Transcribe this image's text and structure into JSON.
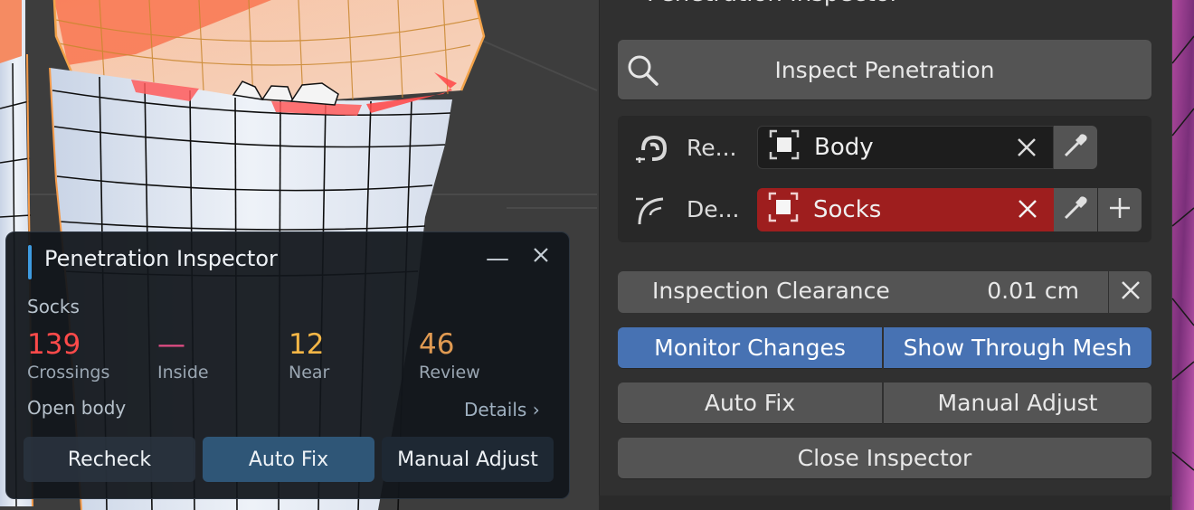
{
  "colors": {
    "accent_blue": "#4772b3",
    "socks_red": "#9e1e1e",
    "crossings": "#ff4a4a",
    "inside": "#e34d85",
    "near": "#f4b646",
    "review": "#e09a52"
  },
  "panel": {
    "title": "Penetration Inspector",
    "inspect_label": "Inspect Penetration",
    "reference_label": "Re...",
    "reference_object": "Body",
    "deformed_label": "De...",
    "deformed_object": "Socks",
    "clearance_label": "Inspection Clearance",
    "clearance_value": "0.01 cm",
    "monitor_label": "Monitor Changes",
    "show_through_label": "Show Through Mesh",
    "auto_fix_label": "Auto Fix",
    "manual_adjust_label": "Manual Adjust",
    "close_label": "Close Inspector"
  },
  "overlay": {
    "title": "Penetration Inspector",
    "minimize_glyph": "—",
    "object": "Socks",
    "stats": [
      {
        "value": "139",
        "label": "Crossings"
      },
      {
        "value": "—",
        "label": "Inside"
      },
      {
        "value": "12",
        "label": "Near"
      },
      {
        "value": "46",
        "label": "Review"
      }
    ],
    "mode": "Open body",
    "details_label": "Details ›",
    "recheck_label": "Recheck",
    "auto_fix_label": "Auto Fix",
    "manual_adjust_label": "Manual Adjust"
  }
}
